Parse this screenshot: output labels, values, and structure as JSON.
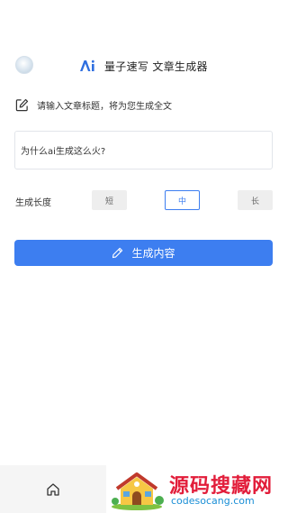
{
  "header": {
    "brand_title": "量子速写 文章生成器",
    "logo_icon": "ai-logo-icon",
    "avatar": "avatar"
  },
  "prompt": {
    "icon": "edit-icon",
    "text": "请输入文章标题，将为您生成全文"
  },
  "topic_input": {
    "value": "为什么ai生成这么火?"
  },
  "length": {
    "label": "生成长度",
    "options": [
      "短",
      "中",
      "长"
    ],
    "selected": "中"
  },
  "generate_button": {
    "label": "生成内容",
    "icon": "pen-icon"
  },
  "bottom_nav": {
    "home_icon": "home-icon"
  },
  "watermark": {
    "title": "源码搜藏网",
    "url": "codesocang.com"
  },
  "colors": {
    "accent": "#3d7ef0",
    "watermark_red": "#e21d3a",
    "watermark_blue": "#1a8fd6"
  }
}
